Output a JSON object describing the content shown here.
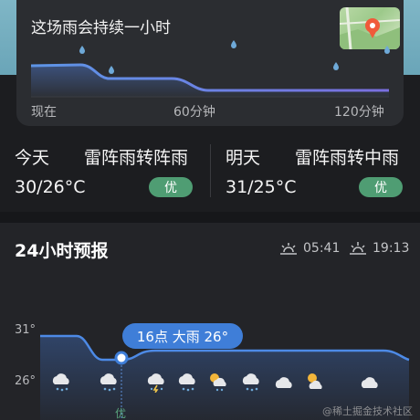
{
  "rain_card": {
    "title": "这场雨会持续一小时",
    "axis_labels": [
      "现在",
      "60分钟",
      "120分钟"
    ],
    "map_icon": "location-pin-map-icon"
  },
  "today": {
    "name": "今天",
    "condition": "雷阵雨转阵雨",
    "temp": "30/26°C",
    "aqi": "优"
  },
  "tomorrow": {
    "name": "明天",
    "condition": "雷阵雨转中雨",
    "temp": "31/25°C",
    "aqi": "优"
  },
  "forecast": {
    "title": "24小时预报",
    "sunrise": "05:41",
    "sunset": "19:13",
    "high_label": "31°",
    "low_label": "26°",
    "tooltip": "16点 大雨 26°",
    "hour_aqi": "优",
    "icons": [
      "rain-cloud-icon",
      "rain-cloud-icon",
      "thunder-rain-icon",
      "rain-cloud-icon",
      "sun-rain-icon",
      "rain-cloud-icon",
      "cloud-icon",
      "sun-cloud-icon",
      "cloud-icon"
    ]
  },
  "watermark": "@稀土掘金技术社区",
  "colors": {
    "accent": "#3f7ed8",
    "aqi_good": "#4f9d73"
  }
}
